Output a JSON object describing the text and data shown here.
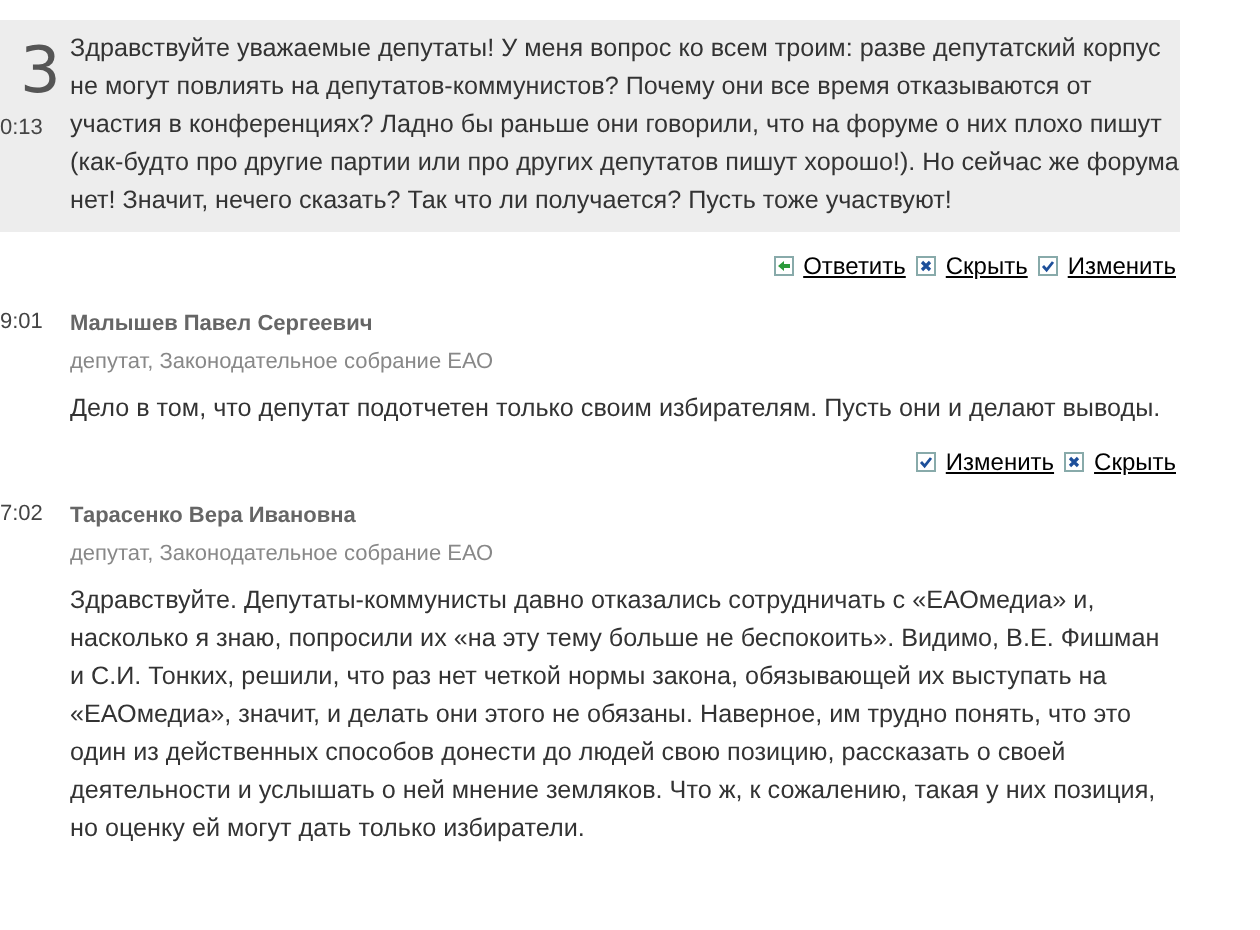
{
  "question": {
    "number": "3",
    "time": "0:13",
    "text": "Здравствуйте уважаемые депутаты! У меня вопрос ко всем троим: разве депутатский корпус не могут повлиять на депутатов-коммунистов? Почему они все время отказываются от участия в конференциях? Ладно бы раньше они говорили, что на форуме о них плохо пишут (как-будто про другие партии или про других депутатов пишут хорошо!). Но сейчас же форума нет! Значит, нечего сказать? Так что ли получается? Пусть тоже участвуют!",
    "actions": [
      {
        "kind": "reply",
        "label": "Ответить"
      },
      {
        "kind": "hide",
        "label": "Скрыть"
      },
      {
        "kind": "edit",
        "label": "Изменить"
      }
    ]
  },
  "answers": [
    {
      "time": "9:01",
      "author": "Малышев Павел Сергеевич",
      "role": "депутат, Законодательное собрание ЕАО",
      "text": "Дело в том, что депутат подотчетен только своим избирателям. Пусть они и делают выводы.",
      "actions": [
        {
          "kind": "edit",
          "label": "Изменить"
        },
        {
          "kind": "hide",
          "label": "Скрыть"
        }
      ]
    },
    {
      "time": "7:02",
      "author": "Тарасенко Вера Ивановна",
      "role": "депутат, Законодательное собрание ЕАО",
      "text": "Здравствуйте. Депутаты-коммунисты давно отказались сотрудничать с «ЕАОмедиа» и, насколько я знаю, попросили их «на эту тему больше не беспокоить». Видимо, В.Е. Фишман и С.И. Тонких, решили, что раз нет четкой нормы закона, обязывающей их выступать на «ЕАОмедиа», значит, и делать они этого не обязаны. Наверное, им трудно понять, что это один из действенных способов донести до людей свою позицию, рассказать о своей деятельности и услышать о ней мнение земляков. Что ж, к сожалению, такая у них позиция, но оценку ей могут дать только избиратели."
    }
  ]
}
